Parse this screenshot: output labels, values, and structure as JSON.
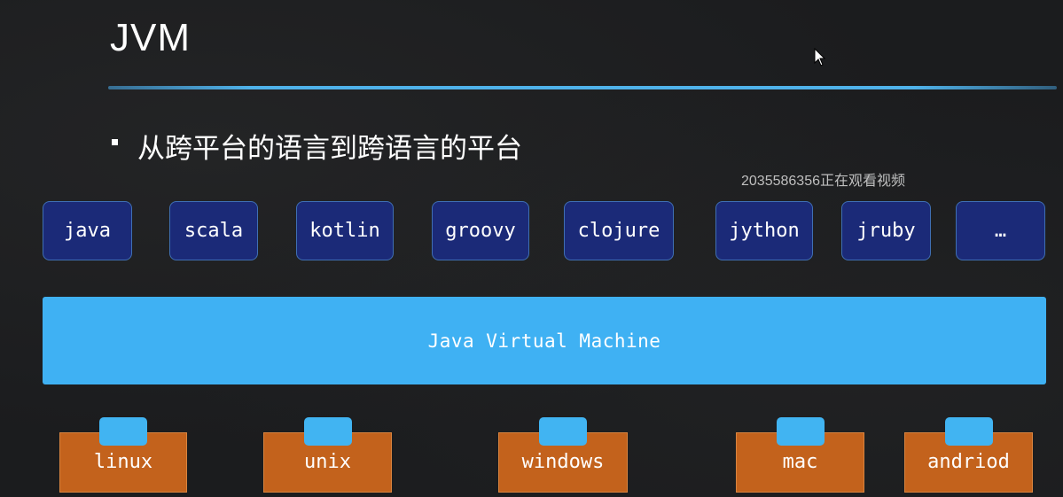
{
  "slide": {
    "title": "JVM",
    "subtitle": "从跨平台的语言到跨语言的平台",
    "watermark": "2035586356正在观看视频"
  },
  "languages": [
    "java",
    "scala",
    "kotlin",
    "groovy",
    "clojure",
    "jython",
    "jruby",
    "…"
  ],
  "vm": {
    "label": "Java Virtual Machine"
  },
  "platforms": [
    "linux",
    "unix",
    "windows",
    "mac",
    "andriod"
  ],
  "colors": {
    "background": "#1b1c1e",
    "language_box": "#1b2a78",
    "vm_box": "#3fb1f3",
    "platform_box": "#c3621c",
    "platform_tab": "#41b4f2",
    "title_rule": "#4fb2ea"
  }
}
